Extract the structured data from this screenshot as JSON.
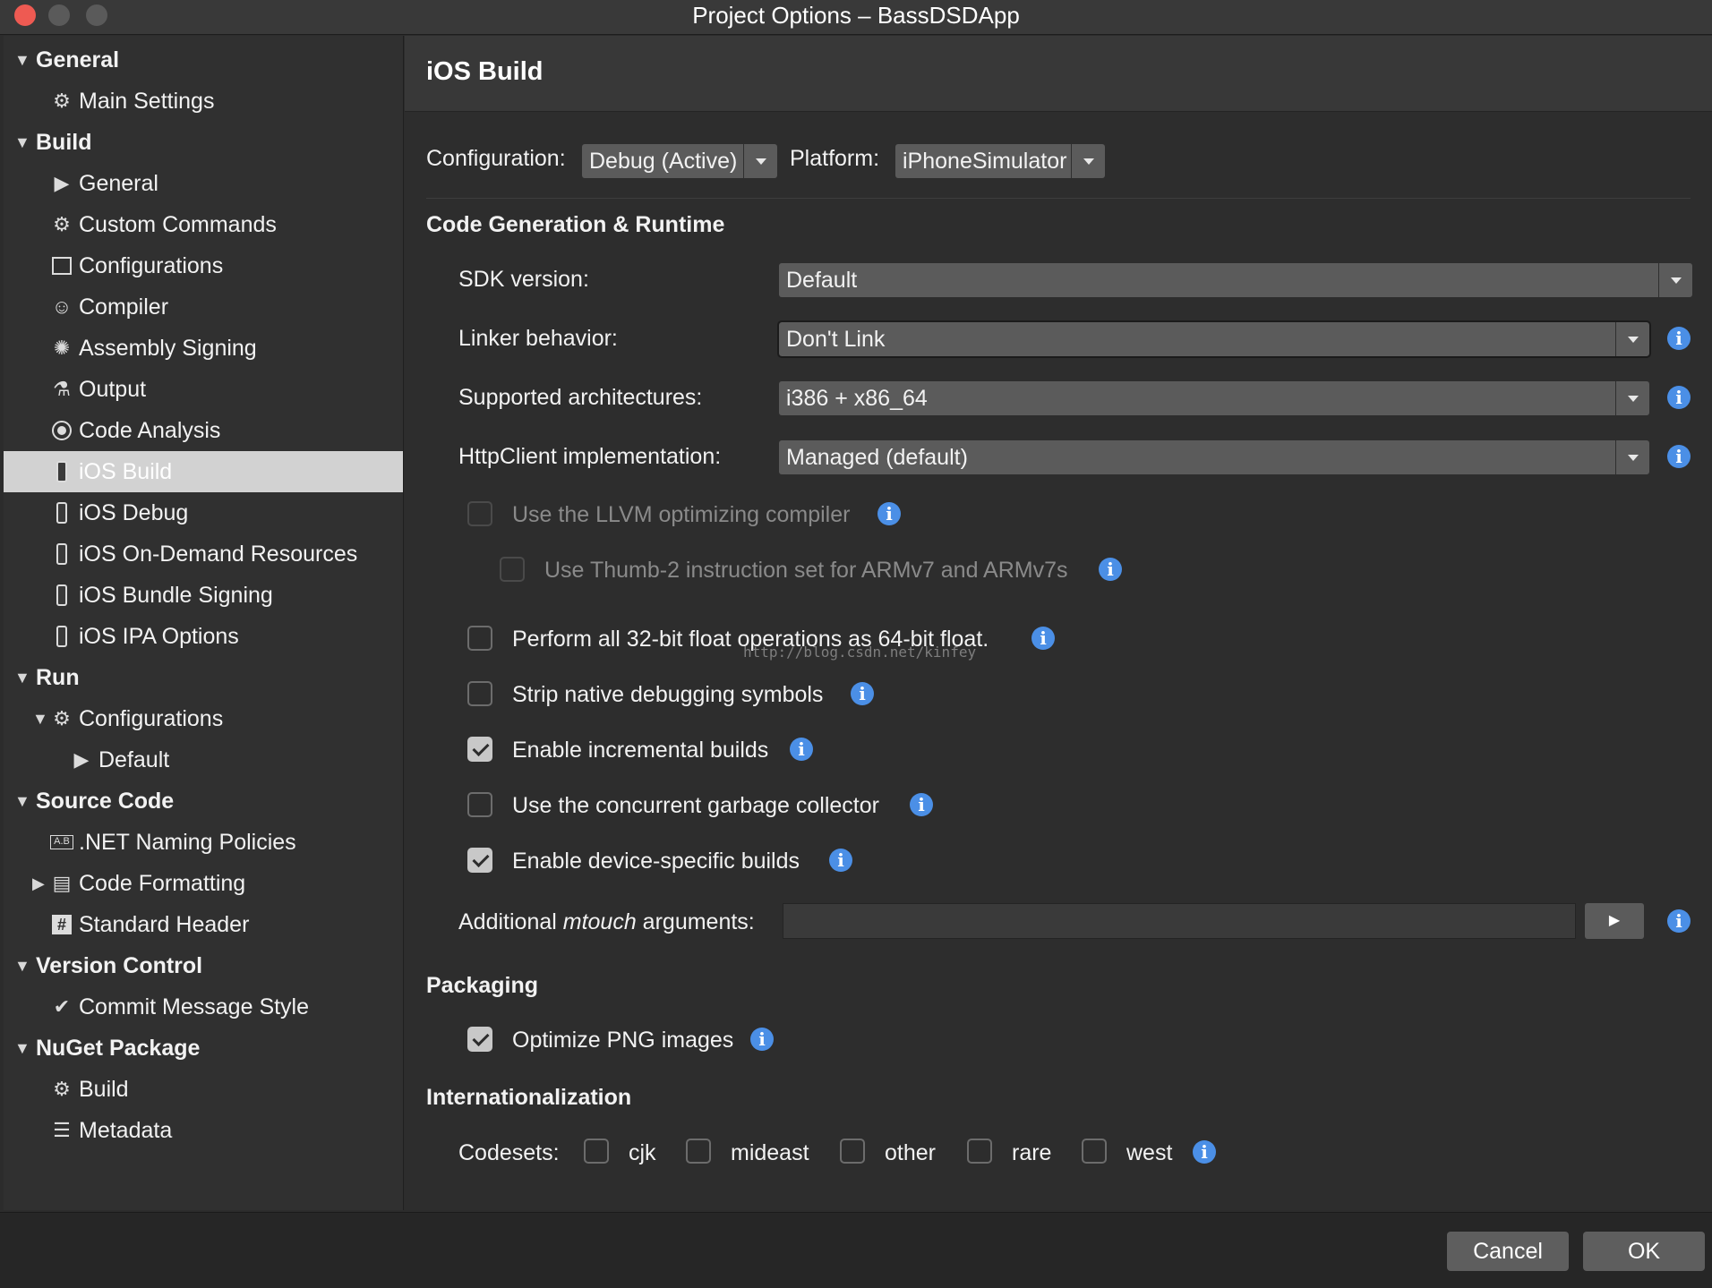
{
  "window": {
    "title": "Project Options – BassDSDApp"
  },
  "sidebar": {
    "items": [
      {
        "label": "General",
        "level": 0,
        "group": true,
        "disclosure": "▼",
        "icon": ""
      },
      {
        "label": "Main Settings",
        "level": 1,
        "icon": "gear-icon"
      },
      {
        "label": "Build",
        "level": 0,
        "group": true,
        "disclosure": "▼",
        "icon": ""
      },
      {
        "label": "General",
        "level": 1,
        "icon": "play-bar-icon"
      },
      {
        "label": "Custom Commands",
        "level": 1,
        "icon": "gear-icon"
      },
      {
        "label": "Configurations",
        "level": 1,
        "icon": "box-icon"
      },
      {
        "label": "Compiler",
        "level": 1,
        "icon": "robot-icon"
      },
      {
        "label": "Assembly Signing",
        "level": 1,
        "icon": "seal-icon"
      },
      {
        "label": "Output",
        "level": 1,
        "icon": "flask-icon"
      },
      {
        "label": "Code Analysis",
        "level": 1,
        "icon": "target-icon"
      },
      {
        "label": "iOS Build",
        "level": 1,
        "icon": "phone-icon",
        "selected": true
      },
      {
        "label": "iOS Debug",
        "level": 1,
        "icon": "phone-icon"
      },
      {
        "label": "iOS On-Demand Resources",
        "level": 1,
        "icon": "phone-icon"
      },
      {
        "label": "iOS Bundle Signing",
        "level": 1,
        "icon": "phone-icon"
      },
      {
        "label": "iOS IPA Options",
        "level": 1,
        "icon": "phone-icon"
      },
      {
        "label": "Run",
        "level": 0,
        "group": true,
        "disclosure": "▼",
        "icon": ""
      },
      {
        "label": "Configurations",
        "level": 1,
        "icon": "gear-icon",
        "disclosure": "▼"
      },
      {
        "label": "Default",
        "level": 2,
        "icon": "play-icon"
      },
      {
        "label": "Source Code",
        "level": 0,
        "group": true,
        "disclosure": "▼",
        "icon": ""
      },
      {
        "label": ".NET Naming Policies",
        "level": 1,
        "icon": "naming-icon"
      },
      {
        "label": "Code Formatting",
        "level": 1,
        "icon": "document-icon",
        "disclosure": "▶"
      },
      {
        "label": "Standard Header",
        "level": 1,
        "icon": "hash-icon"
      },
      {
        "label": "Version Control",
        "level": 0,
        "group": true,
        "disclosure": "▼",
        "icon": ""
      },
      {
        "label": "Commit Message Style",
        "level": 1,
        "icon": "check-circle-icon"
      },
      {
        "label": "NuGet Package",
        "level": 0,
        "group": true,
        "disclosure": "▼",
        "icon": ""
      },
      {
        "label": "Build",
        "level": 1,
        "icon": "gear-icon"
      },
      {
        "label": "Metadata",
        "level": 1,
        "icon": "list-icon"
      }
    ]
  },
  "main": {
    "title": "iOS Build",
    "configuration": {
      "label": "Configuration:",
      "value": "Debug (Active)"
    },
    "platform": {
      "label": "Platform:",
      "value": "iPhoneSimulator"
    },
    "sections": {
      "codegen": "Code Generation & Runtime",
      "packaging": "Packaging",
      "i18n": "Internationalization"
    },
    "fields": {
      "sdk": {
        "label": "SDK version:",
        "value": "Default"
      },
      "linker": {
        "label": "Linker behavior:",
        "value": "Don't Link"
      },
      "arch": {
        "label": "Supported architectures:",
        "value": "i386 + x86_64"
      },
      "http": {
        "label": "HttpClient implementation:",
        "value": "Managed (default)"
      }
    },
    "checkboxes": {
      "llvm": {
        "label": "Use the LLVM optimizing compiler",
        "checked": false,
        "enabled": false
      },
      "thumb": {
        "label": "Use Thumb-2 instruction set for ARMv7 and ARMv7s",
        "checked": false,
        "enabled": false
      },
      "float64": {
        "label": "Perform all 32-bit float operations as 64-bit float.",
        "checked": false,
        "enabled": true
      },
      "strip": {
        "label": "Strip native debugging symbols",
        "checked": false,
        "enabled": true
      },
      "incremental": {
        "label": "Enable incremental builds",
        "checked": true,
        "enabled": true
      },
      "gc": {
        "label": "Use the concurrent garbage collector",
        "checked": false,
        "enabled": true
      },
      "device": {
        "label": "Enable device-specific builds",
        "checked": true,
        "enabled": true
      },
      "png": {
        "label": "Optimize PNG images",
        "checked": true,
        "enabled": true
      }
    },
    "mtouch": {
      "label_pre": "Additional ",
      "label_em": "mtouch",
      "label_post": " arguments:",
      "value": "",
      "button": "▶"
    },
    "codesets": {
      "label": "Codesets:",
      "items": [
        {
          "label": "cjk",
          "checked": false
        },
        {
          "label": "mideast",
          "checked": false
        },
        {
          "label": "other",
          "checked": false
        },
        {
          "label": "rare",
          "checked": false
        },
        {
          "label": "west",
          "checked": false
        }
      ]
    },
    "watermark": "http://blog.csdn.net/kinfey",
    "info_glyph": "i"
  },
  "footer": {
    "cancel": "Cancel",
    "ok": "OK"
  },
  "colors": {
    "accent_info": "#4b8fe6",
    "close_button": "#ee5a52",
    "selection": "#d2d2d2"
  }
}
